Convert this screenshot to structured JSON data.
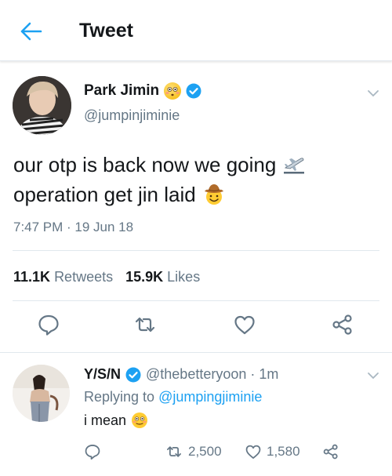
{
  "header": {
    "title": "Tweet",
    "back_icon": "arrow-left-icon",
    "accent": "#1da1f2"
  },
  "tweet": {
    "author": {
      "name": "Park Jimin",
      "handle": "@jumpinjiminie",
      "name_emoji": "flushed-face-emoji",
      "verified": true
    },
    "text_line1": "our otp is back now we going",
    "text_line1_emoji": "airplane-departure-emoji",
    "text_line2": "operation get jin laid",
    "text_line2_emoji": "cowboy-hat-face-emoji",
    "timestamp": "7:47 PM · 19 Jun 18",
    "stats": {
      "retweets_count": "11.1K",
      "retweets_label": "Retweets",
      "likes_count": "15.9K",
      "likes_label": "Likes"
    },
    "actions": [
      "reply-icon",
      "retweet-icon",
      "like-icon",
      "share-icon"
    ]
  },
  "reply": {
    "author_name": "Y/S/N",
    "verified": true,
    "handle_time": "@thebetteryoon · 1m",
    "replying_prefix": "Replying to",
    "replying_to": "@jumpingjiminie",
    "text": "i mean",
    "text_emoji": "smiling-face-emoji",
    "retweets": "2,500",
    "likes": "1,580"
  },
  "colors": {
    "text_primary": "#14171a",
    "text_secondary": "#657786",
    "divider": "#e1e8ed",
    "verified": "#1da1f2"
  }
}
